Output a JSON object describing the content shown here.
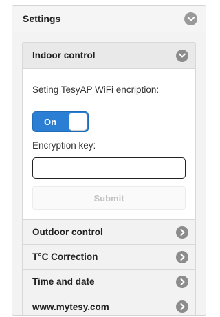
{
  "settings": {
    "title": "Settings",
    "toggle_icon": "chevron-down-icon"
  },
  "indoor": {
    "title": "Indoor control",
    "toggle_icon": "chevron-down-icon",
    "encryption_label": "Seting TesyAP WiFi encription:",
    "switch": {
      "label": "On",
      "state": "on"
    },
    "key_label": "Encryption key:",
    "key_value": "",
    "submit_label": "Submit"
  },
  "sections": [
    {
      "title": "Outdoor control",
      "icon": "chevron-right-icon"
    },
    {
      "title": "T°C Correction",
      "icon": "chevron-right-icon"
    },
    {
      "title": "Time and date",
      "icon": "chevron-right-icon"
    },
    {
      "title": "www.mytesy.com",
      "icon": "chevron-right-icon"
    }
  ],
  "colors": {
    "accent": "#2a7fd4",
    "icon_gray": "#8c8c8c"
  }
}
